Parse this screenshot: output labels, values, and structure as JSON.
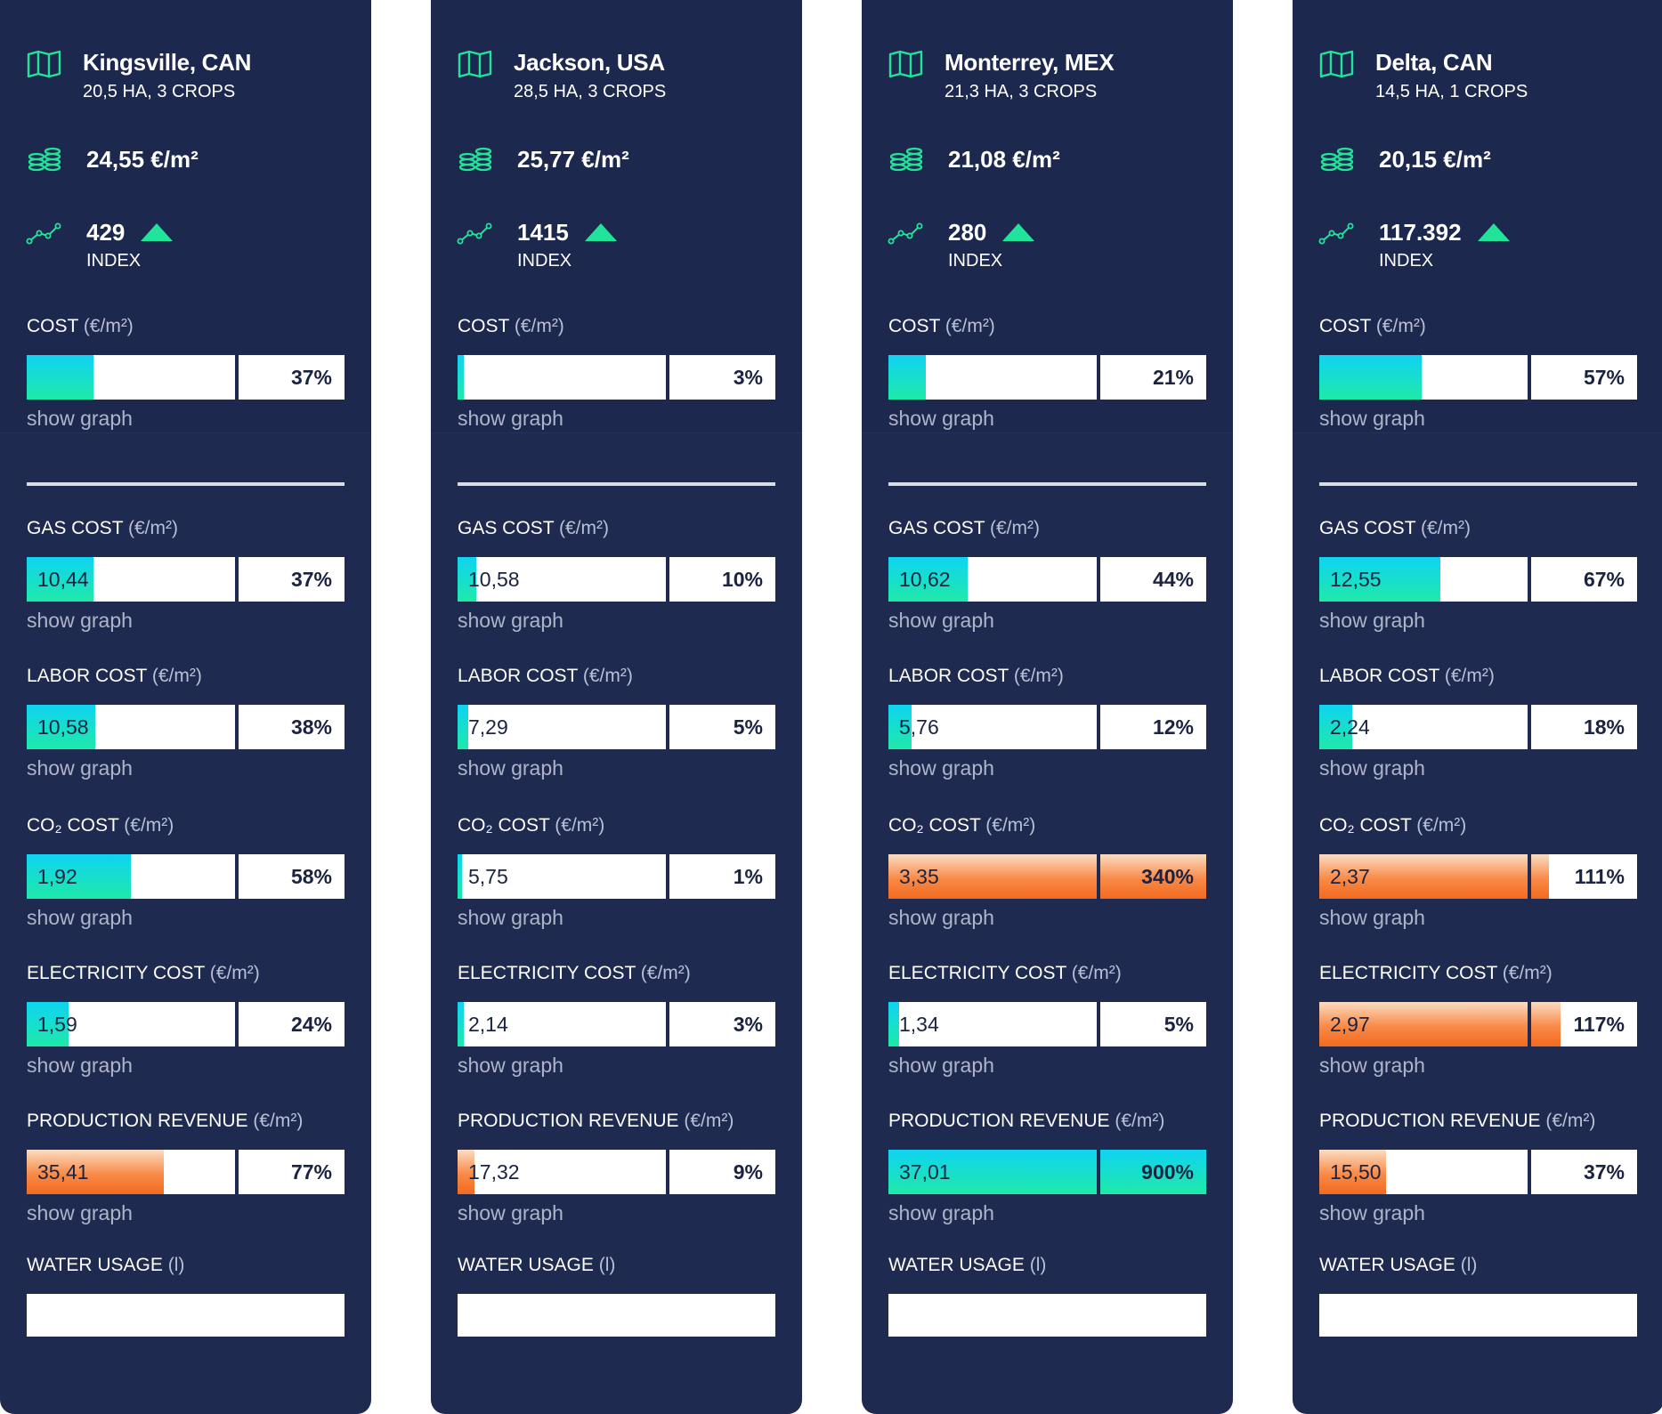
{
  "colors": {
    "card_bg": "#1e2a50",
    "accent_green": "#22e39a",
    "fill_cyan": "#0fd3f2",
    "fill_green": "#1fe9a8",
    "fill_orange": "#f26a1f"
  },
  "icons": [
    "map-icon",
    "coins-icon",
    "trend-line-icon",
    "arrow-up-icon"
  ],
  "cards": [
    {
      "location": "Kingsville, CAN",
      "details": "20,5 HA, 3 CROPS",
      "price": "24,55 €/m²",
      "index_value": "429",
      "index_label": "INDEX",
      "cost": {
        "label": "COST",
        "unit": "(€/m²)",
        "value": "",
        "percent": "37%",
        "fill_left": 0.32,
        "fill_right": 0,
        "color": "cyan",
        "link": "show graph"
      },
      "metrics": [
        {
          "label": "GAS COST",
          "unit": "(€/m²)",
          "value": "10,44",
          "percent": "37%",
          "fill_left": 0.32,
          "fill_right": 0,
          "color": "cyan",
          "link": "show graph"
        },
        {
          "label": "LABOR COST",
          "unit": "(€/m²)",
          "value": "10,58",
          "percent": "38%",
          "fill_left": 0.33,
          "fill_right": 0,
          "color": "cyan",
          "link": "show graph"
        },
        {
          "label": "CO₂ COST",
          "unit": "(€/m²)",
          "value": "1,92",
          "percent": "58%",
          "fill_left": 0.5,
          "fill_right": 0,
          "color": "cyan",
          "link": "show graph"
        },
        {
          "label": "ELECTRICITY COST",
          "unit": "(€/m²)",
          "value": "1,59",
          "percent": "24%",
          "fill_left": 0.2,
          "fill_right": 0,
          "color": "cyan",
          "link": "show graph"
        },
        {
          "label": "PRODUCTION REVENUE",
          "unit": "(€/m²)",
          "value": "35,41",
          "percent": "77%",
          "fill_left": 0.66,
          "fill_right": 0,
          "color": "orange",
          "link": "show graph"
        }
      ],
      "water": {
        "label": "WATER USAGE",
        "unit": "(l)"
      }
    },
    {
      "location": "Jackson, USA",
      "details": "28,5 HA, 3 CROPS",
      "price": "25,77 €/m²",
      "index_value": "1415",
      "index_label": "INDEX",
      "cost": {
        "label": "COST",
        "unit": "(€/m²)",
        "value": "",
        "percent": "3%",
        "fill_left": 0.03,
        "fill_right": 0,
        "color": "cyan",
        "link": "show graph"
      },
      "metrics": [
        {
          "label": "GAS COST",
          "unit": "(€/m²)",
          "value": "10,58",
          "percent": "10%",
          "fill_left": 0.09,
          "fill_right": 0,
          "color": "cyan",
          "link": "show graph"
        },
        {
          "label": "LABOR COST",
          "unit": "(€/m²)",
          "value": "7,29",
          "percent": "5%",
          "fill_left": 0.05,
          "fill_right": 0,
          "color": "cyan",
          "link": "show graph"
        },
        {
          "label": "CO₂ COST",
          "unit": "(€/m²)",
          "value": "5,75",
          "percent": "1%",
          "fill_left": 0.02,
          "fill_right": 0,
          "color": "cyan",
          "link": "show graph"
        },
        {
          "label": "ELECTRICITY COST",
          "unit": "(€/m²)",
          "value": "2,14",
          "percent": "3%",
          "fill_left": 0.03,
          "fill_right": 0,
          "color": "cyan",
          "link": "show graph"
        },
        {
          "label": "PRODUCTION REVENUE",
          "unit": "(€/m²)",
          "value": "17,32",
          "percent": "9%",
          "fill_left": 0.08,
          "fill_right": 0,
          "color": "orange",
          "link": "show graph"
        }
      ],
      "water": {
        "label": "WATER USAGE",
        "unit": "(l)"
      }
    },
    {
      "location": "Monterrey, MEX",
      "details": "21,3 HA, 3 CROPS",
      "price": "21,08 €/m²",
      "index_value": "280",
      "index_label": "INDEX",
      "cost": {
        "label": "COST",
        "unit": "(€/m²)",
        "value": "",
        "percent": "21%",
        "fill_left": 0.18,
        "fill_right": 0,
        "color": "cyan",
        "link": "show graph"
      },
      "metrics": [
        {
          "label": "GAS COST",
          "unit": "(€/m²)",
          "value": "10,62",
          "percent": "44%",
          "fill_left": 0.38,
          "fill_right": 0,
          "color": "cyan",
          "link": "show graph"
        },
        {
          "label": "LABOR COST",
          "unit": "(€/m²)",
          "value": "5,76",
          "percent": "12%",
          "fill_left": 0.11,
          "fill_right": 0,
          "color": "cyan",
          "link": "show graph"
        },
        {
          "label": "CO₂ COST",
          "unit": "(€/m²)",
          "value": "3,35",
          "percent": "340%",
          "fill_left": 1,
          "fill_right": 1,
          "color": "orange",
          "link": "show graph"
        },
        {
          "label": "ELECTRICITY COST",
          "unit": "(€/m²)",
          "value": "1,34",
          "percent": "5%",
          "fill_left": 0.05,
          "fill_right": 0,
          "color": "cyan",
          "link": "show graph"
        },
        {
          "label": "PRODUCTION REVENUE",
          "unit": "(€/m²)",
          "value": "37,01",
          "percent": "900%",
          "fill_left": 1,
          "fill_right": 1,
          "color": "cyan",
          "link": "show graph"
        }
      ],
      "water": {
        "label": "WATER USAGE",
        "unit": "(l)"
      }
    },
    {
      "location": "Delta, CAN",
      "details": "14,5 HA, 1 CROPS",
      "price": "20,15 €/m²",
      "index_value": "117.392",
      "index_label": "INDEX",
      "cost": {
        "label": "COST",
        "unit": "(€/m²)",
        "value": "",
        "percent": "57%",
        "fill_left": 0.49,
        "fill_right": 0,
        "color": "cyan",
        "link": "show graph"
      },
      "metrics": [
        {
          "label": "GAS COST",
          "unit": "(€/m²)",
          "value": "12,55",
          "percent": "67%",
          "fill_left": 0.58,
          "fill_right": 0,
          "color": "cyan",
          "link": "show graph"
        },
        {
          "label": "LABOR COST",
          "unit": "(€/m²)",
          "value": "2,24",
          "percent": "18%",
          "fill_left": 0.16,
          "fill_right": 0,
          "color": "cyan",
          "link": "show graph"
        },
        {
          "label": "CO₂ COST",
          "unit": "(€/m²)",
          "value": "2,37",
          "percent": "111%",
          "fill_left": 1,
          "fill_right": 0.17,
          "color": "orange",
          "link": "show graph"
        },
        {
          "label": "ELECTRICITY COST",
          "unit": "(€/m²)",
          "value": "2,97",
          "percent": "117%",
          "fill_left": 1,
          "fill_right": 0.28,
          "color": "orange",
          "link": "show graph"
        },
        {
          "label": "PRODUCTION REVENUE",
          "unit": "(€/m²)",
          "value": "15,50",
          "percent": "37%",
          "fill_left": 0.32,
          "fill_right": 0,
          "color": "orange",
          "link": "show graph"
        }
      ],
      "water": {
        "label": "WATER USAGE",
        "unit": "(l)"
      }
    }
  ]
}
